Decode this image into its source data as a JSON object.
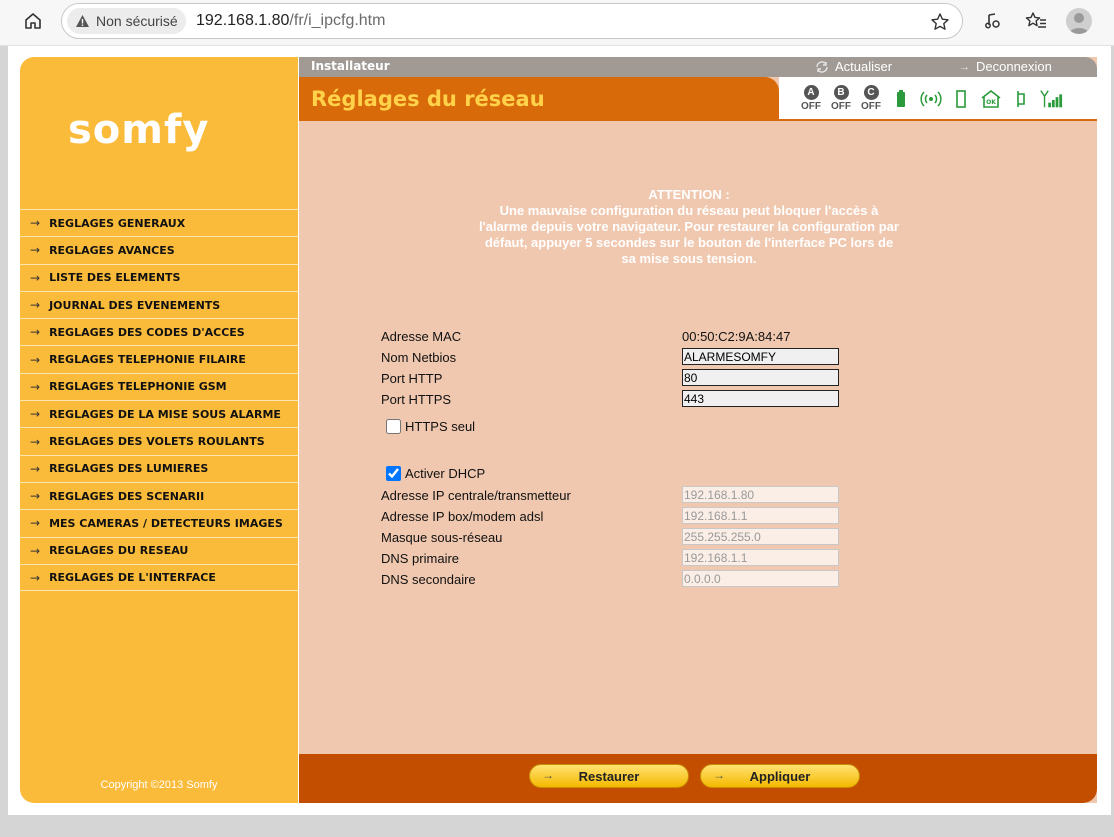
{
  "browser": {
    "security_label": "Non sécurisé",
    "url_host": "192.168.1.80",
    "url_path": "/fr/i_ipcfg.htm"
  },
  "sidebar": {
    "logo": "somfy",
    "copyright": "Copyright ©2013 Somfy",
    "items": [
      {
        "label": "REGLAGES GENERAUX"
      },
      {
        "label": "REGLAGES AVANCES"
      },
      {
        "label": "LISTE DES ELEMENTS"
      },
      {
        "label": "JOURNAL DES EVENEMENTS"
      },
      {
        "label": "REGLAGES DES CODES D'ACCES"
      },
      {
        "label": "REGLAGES TELEPHONIE FILAIRE"
      },
      {
        "label": "REGLAGES TELEPHONIE GSM"
      },
      {
        "label": "REGLAGES DE LA MISE SOUS ALARME"
      },
      {
        "label": "REGLAGES DES VOLETS ROULANTS"
      },
      {
        "label": "REGLAGES DES LUMIERES"
      },
      {
        "label": "REGLAGES DES SCENARII"
      },
      {
        "label": "MES CAMERAS / DETECTEURS IMAGES"
      },
      {
        "label": "REGLAGES DU RESEAU"
      },
      {
        "label": "REGLAGES DE L'INTERFACE"
      }
    ]
  },
  "header": {
    "role": "Installateur",
    "refresh": "Actualiser",
    "logout": "Deconnexion",
    "title": "Réglages du réseau"
  },
  "status": {
    "zones": [
      {
        "letter": "A",
        "state": "OFF"
      },
      {
        "letter": "B",
        "state": "OFF"
      },
      {
        "letter": "C",
        "state": "OFF"
      }
    ],
    "icons": [
      "battery-icon",
      "radio-signal-icon",
      "door-icon",
      "home-ok-icon",
      "phone-icon",
      "gsm-signal-icon"
    ],
    "colors": {
      "green": "#2a9a3a",
      "dark": "#555555"
    }
  },
  "warning": {
    "title": "ATTENTION :",
    "text": "Une mauvaise configuration du réseau peut bloquer l'accès à l'alarme depuis votre navigateur. Pour restaurer la configuration par défaut, appuyer 5 secondes sur le bouton de l'interface PC lors de sa mise sous tension."
  },
  "form": {
    "mac_label": "Adresse MAC",
    "mac_value": "00:50:C2:9A:84:47",
    "netbios_label": "Nom Netbios",
    "netbios_value": "ALARMESOMFY",
    "http_label": "Port HTTP",
    "http_value": "80",
    "https_label": "Port HTTPS",
    "https_value": "443",
    "https_only_label": "HTTPS seul",
    "dhcp_label": "Activer DHCP",
    "ip_central_label": "Adresse IP centrale/transmetteur",
    "ip_central_value": "192.168.1.80",
    "ip_box_label": "Adresse IP box/modem adsl",
    "ip_box_value": "192.168.1.1",
    "mask_label": "Masque sous-réseau",
    "mask_value": "255.255.255.0",
    "dns1_label": "DNS primaire",
    "dns1_value": "192.168.1.1",
    "dns2_label": "DNS secondaire",
    "dns2_value": "0.0.0.0"
  },
  "actions": {
    "restore": "Restaurer",
    "apply": "Appliquer"
  }
}
